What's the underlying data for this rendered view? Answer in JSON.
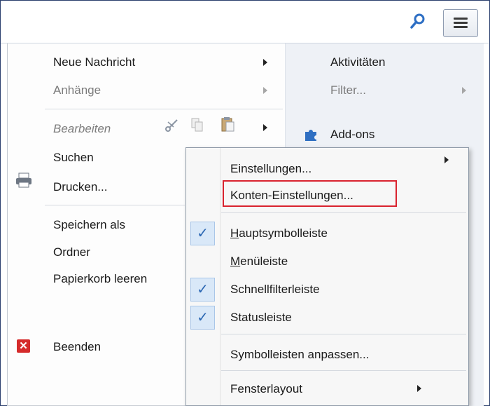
{
  "main_menu": {
    "left": [
      {
        "label": "Neue Nachricht"
      },
      {
        "label": "Anhänge"
      },
      {
        "label": "Bearbeiten"
      },
      {
        "label": "Suchen"
      },
      {
        "label": "Drucken..."
      },
      {
        "label": "Speichern als"
      },
      {
        "label": "Ordner"
      },
      {
        "label": "Papierkorb leeren"
      },
      {
        "label": "Beenden"
      }
    ],
    "right": [
      {
        "label": "Aktivitäten"
      },
      {
        "label": "Filter..."
      },
      {
        "label": "Add-ons"
      }
    ]
  },
  "submenu": {
    "einstellungen": "Einstellungen...",
    "konten": "Konten-Einstellungen...",
    "haupt_first": "H",
    "haupt_rest": "auptsymbolleiste",
    "menu_first": "M",
    "menu_rest": "enüleiste",
    "schnellfilter": "Schnellfilterleiste",
    "status": "Statusleiste",
    "anpassen": "Symbolleisten anpassen...",
    "fensterlayout": "Fensterlayout"
  },
  "checks": {
    "hauptsymbolleiste": true,
    "schnellfilterleiste": true,
    "statusleiste": true,
    "mark": "✓"
  },
  "icons": {
    "search": "magnifier-icon",
    "menu": "hamburger-icon",
    "print": "printer-icon",
    "exit": "close-red-icon",
    "addon": "puzzle-icon",
    "edit": [
      "cut-icon",
      "copy-icon",
      "paste-icon"
    ]
  },
  "colors": {
    "highlight_border": "#d9232f",
    "check_bg": "#d9e8f8",
    "accent_blue": "#2b67b3"
  }
}
